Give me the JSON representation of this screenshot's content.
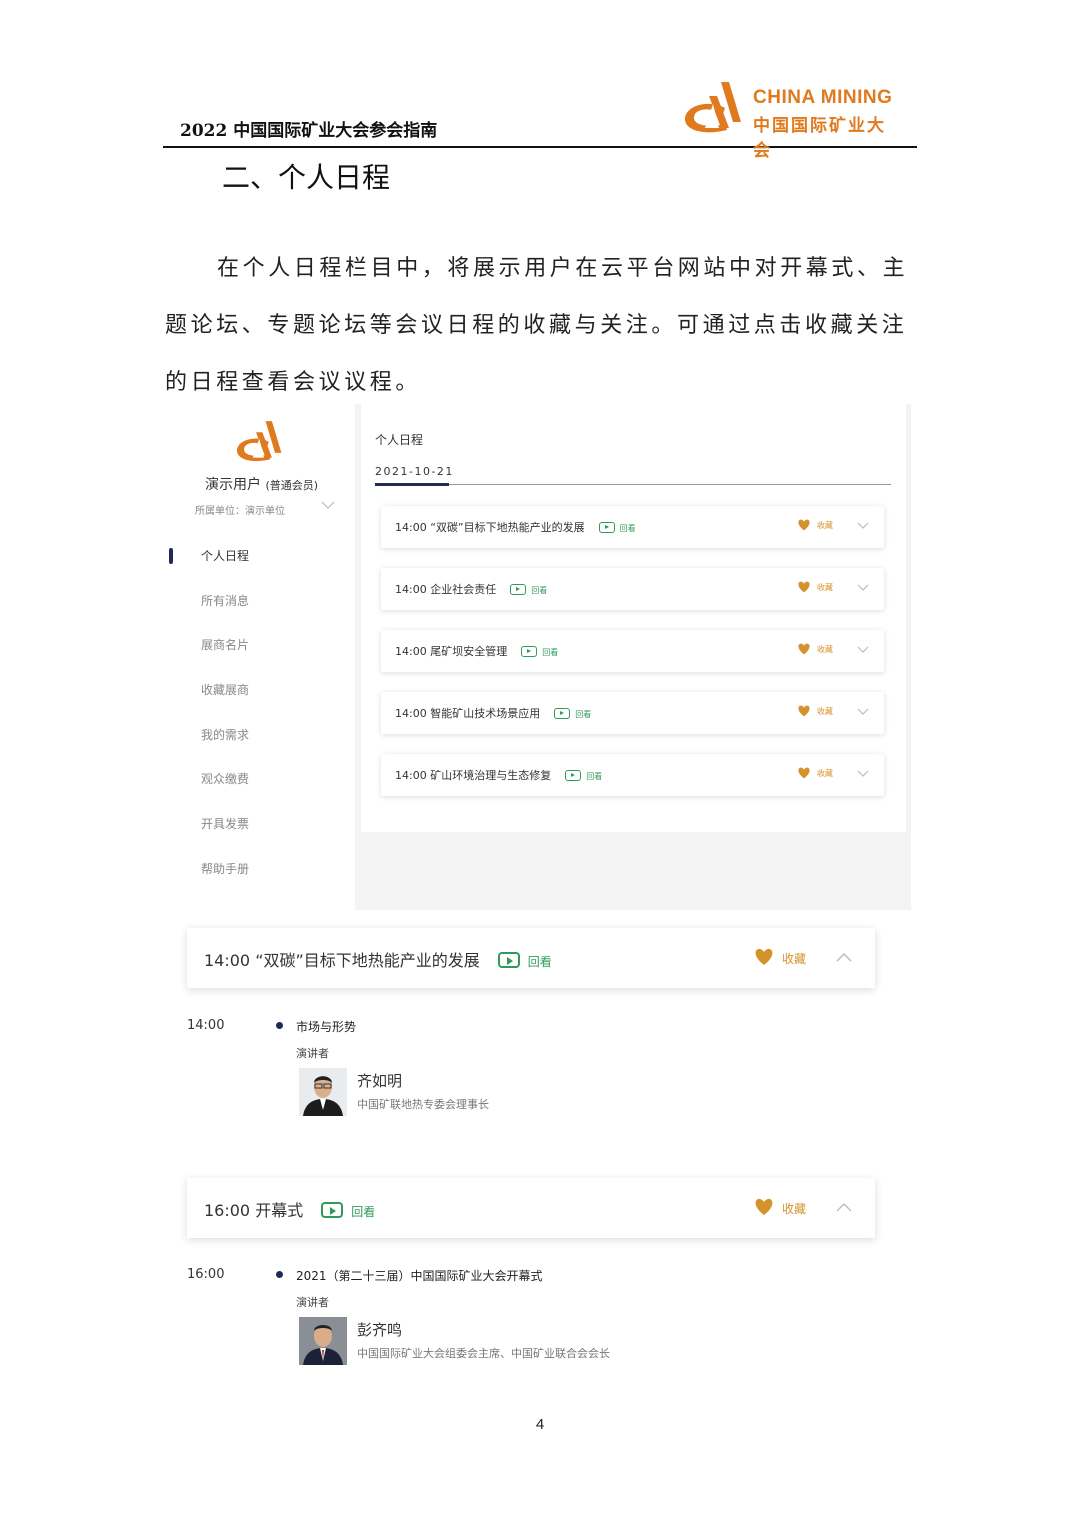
{
  "header": {
    "doc_title": "2022 中国国际矿业大会参会指南",
    "brand_en": "CHINA MINING",
    "brand_cn": "中国国际矿业大会",
    "brand_color": "#e07a1f"
  },
  "section_title": "二、个人日程",
  "paragraph": "在个人日程栏目中，将展示用户在云平台网站中对开幕式、主题论坛、专题论坛等会议日程的收藏与关注。可通过点击收藏关注的日程查看会议议程。",
  "screenshot": {
    "user_name": "演示用户",
    "user_level": "(普通会员)",
    "unit": "所属单位：演示单位",
    "menu": [
      {
        "label": "个人日程",
        "active": true
      },
      {
        "label": "所有消息",
        "active": false
      },
      {
        "label": "展商名片",
        "active": false
      },
      {
        "label": "收藏展商",
        "active": false
      },
      {
        "label": "我的需求",
        "active": false
      },
      {
        "label": "观众缴费",
        "active": false
      },
      {
        "label": "开具发票",
        "active": false
      },
      {
        "label": "帮助手册",
        "active": false
      }
    ],
    "main_title": "个人日程",
    "date": "2021-10-21",
    "schedule": [
      {
        "text": "14:00 “双碳”目标下地热能产业的发展",
        "replay": "回看",
        "fav": "收藏"
      },
      {
        "text": "14:00 企业社会责任",
        "replay": "回看",
        "fav": "收藏"
      },
      {
        "text": "14:00 尾矿坝安全管理",
        "replay": "回看",
        "fav": "收藏"
      },
      {
        "text": "14:00 智能矿山技术场景应用",
        "replay": "回看",
        "fav": "收藏"
      },
      {
        "text": "14:00 矿山环境治理与生态修复",
        "replay": "回看",
        "fav": "收藏"
      }
    ]
  },
  "cards": [
    {
      "header": "14:00 “双碳”目标下地热能产业的发展",
      "replay": "回看",
      "fav": "收藏",
      "time": "14:00",
      "topic": "市场与形势",
      "speaker_label": "演讲者",
      "speaker_name": "齐如明",
      "speaker_title": "中国矿联地热专委会理事长"
    },
    {
      "header": "16:00 开幕式",
      "replay": "回看",
      "fav": "收藏",
      "time": "16:00",
      "topic": "2021（第二十三届）中国国际矿业大会开幕式",
      "speaker_label": "演讲者",
      "speaker_name": "彭齐鸣",
      "speaker_title": "中国国际矿业大会组委会主席、中国矿业联合会会长"
    }
  ],
  "page_number": "4",
  "colors": {
    "replay_green": "#2e9b5a",
    "fav_gold": "#d4932a",
    "nav_dark": "#1f2a55"
  },
  "icons": [
    "mountain-logo-icon",
    "play-icon",
    "heart-icon",
    "chevron-down-icon",
    "chevron-up-icon"
  ]
}
